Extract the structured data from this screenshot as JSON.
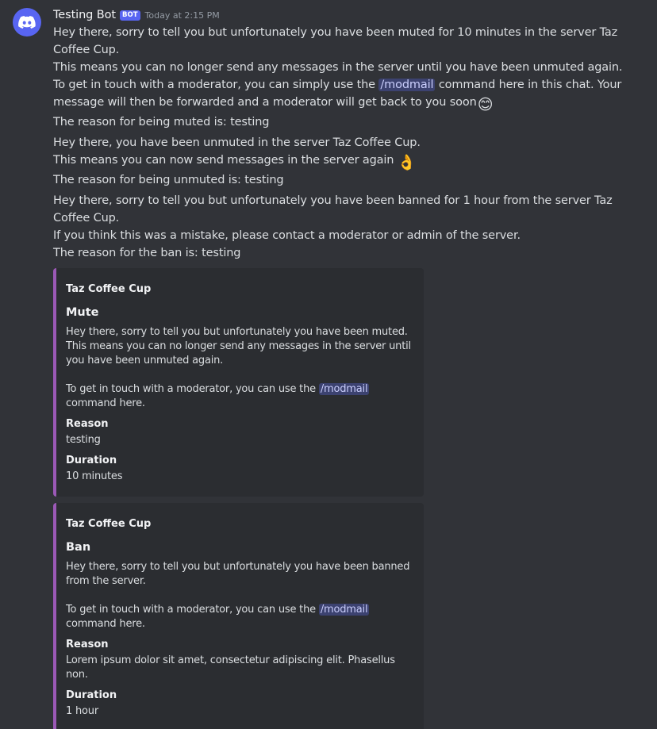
{
  "message": {
    "username": "Testing Bot",
    "bot_tag": "BOT",
    "timestamp": "Today at 2:15 PM",
    "avatar_icon": "discord-logo-icon",
    "colors": {
      "avatar_bg": "#5865f2",
      "embed_border": "#9b59b6",
      "mention_bg": "#3c4270"
    },
    "mute_dm": {
      "line1": "Hey there, sorry to tell you but unfortunately you have been muted for 10 minutes in the server Taz Coffee Cup.",
      "line2": "This means you can no longer send any messages in the server until you have been unmuted again.",
      "line3_before": "To get in touch with a moderator, you can simply use the",
      "line3_command": "/modmail",
      "line3_after": "command here in this chat. Your message will then be forwarded and a moderator will get back to you soon",
      "line3_emoji": "😊",
      "line4": "The reason for being muted is: testing"
    },
    "unmute_dm": {
      "line1": "Hey there, you have been unmuted in the server Taz Coffee Cup.",
      "line2": "This means you can now send messages in the server again",
      "line2_emoji": "👌",
      "line3": "The reason for being unmuted is: testing"
    },
    "ban_dm": {
      "line1": "Hey there, sorry to tell you but unfortunately you have been banned for 1 hour from the server Taz Coffee Cup.",
      "line2": "If you think this was a mistake, please contact a moderator or admin of the server.",
      "line3": "The reason for the ban is: testing"
    },
    "embeds": [
      {
        "author": "Taz Coffee Cup",
        "title": "Mute",
        "desc_para1": "Hey there, sorry to tell you but unfortunately you have been muted. This means you can no longer send any messages in the server until you have been unmuted again.",
        "desc_para2_before": "To get in touch with a moderator, you can use the",
        "desc_para2_command": "/modmail",
        "desc_para2_after": "command here.",
        "fields": [
          {
            "name": "Reason",
            "value": "testing"
          },
          {
            "name": "Duration",
            "value": "10 minutes"
          }
        ]
      },
      {
        "author": "Taz Coffee Cup",
        "title": "Ban",
        "desc_para1": "Hey there, sorry to tell you but unfortunately you have been banned from the server.",
        "desc_para2_before": "To get in touch with a moderator, you can use the",
        "desc_para2_command": "/modmail",
        "desc_para2_after": "command here.",
        "fields": [
          {
            "name": "Reason",
            "value": "Lorem ipsum dolor sit amet, consectetur adipiscing elit. Phasellus non."
          },
          {
            "name": "Duration",
            "value": "1 hour"
          }
        ]
      }
    ]
  }
}
